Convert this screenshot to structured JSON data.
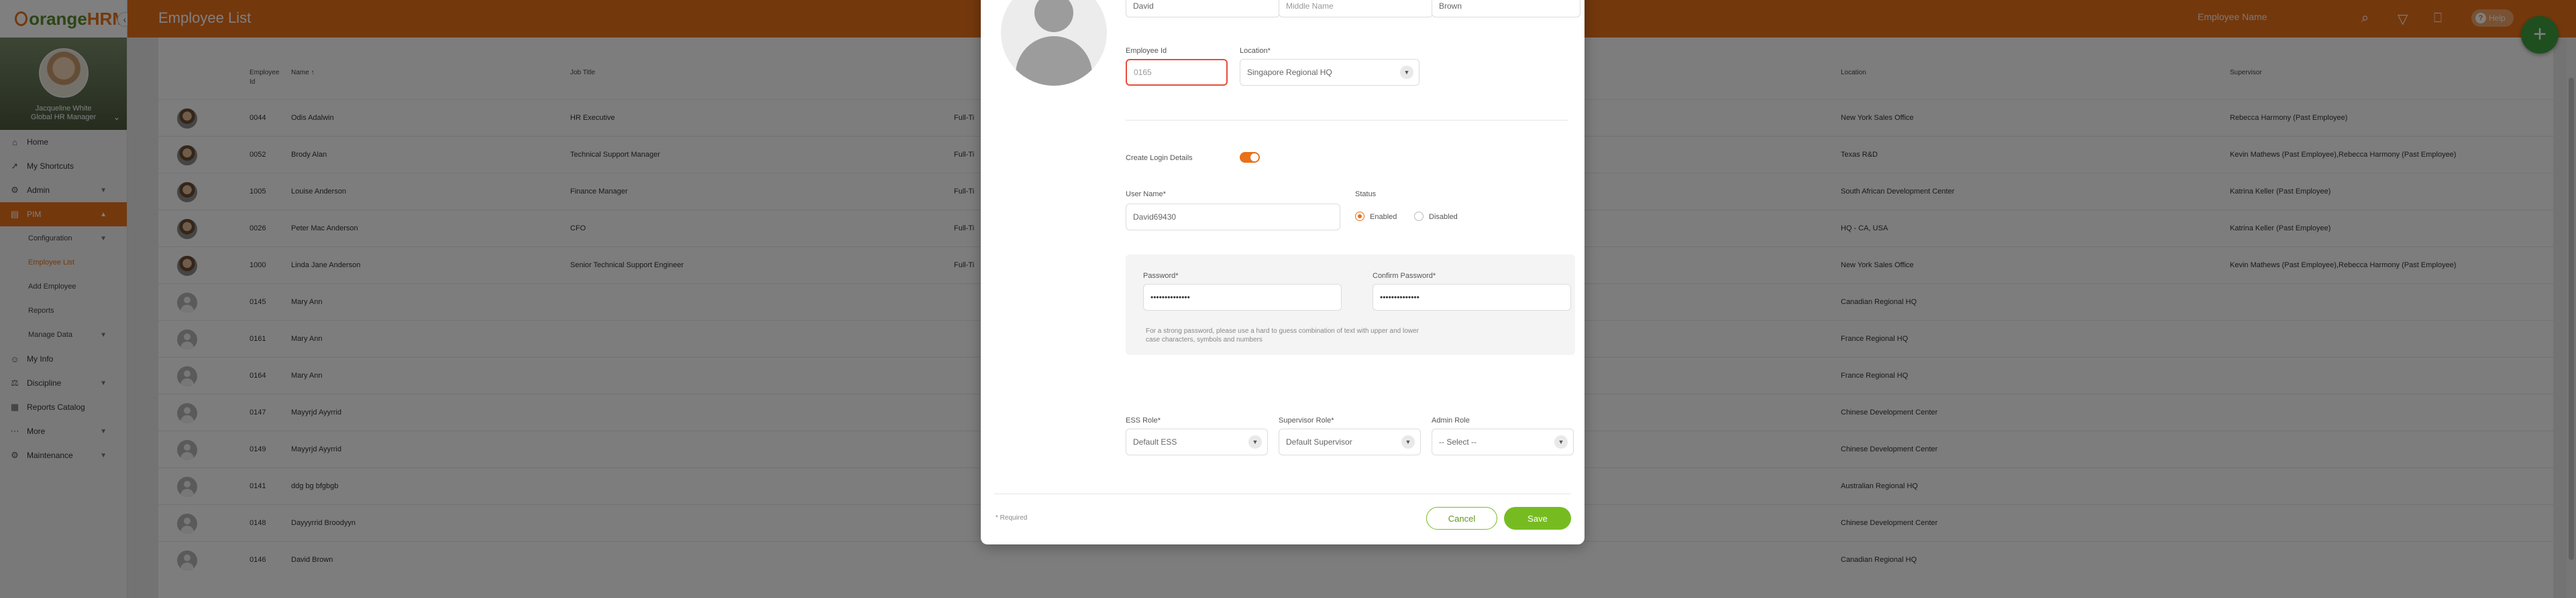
{
  "app": {
    "logo_orange": "orange",
    "logo_hrm": "HRM",
    "page_title": "Employee List",
    "top_search_placeholder": "Employee Name",
    "help_label": "Help",
    "fab_label": "+",
    "collapse_label": "‹"
  },
  "profile": {
    "name": "Jacqueline White",
    "role": "Global HR Manager"
  },
  "sidebar": {
    "items": [
      {
        "label": "Home",
        "icon": "home-icon"
      },
      {
        "label": "My Shortcuts",
        "icon": "shortcut-icon"
      },
      {
        "label": "Admin",
        "icon": "admin-icon"
      },
      {
        "label": "PIM",
        "icon": "pim-icon",
        "active": true
      },
      {
        "label": "Configuration",
        "sub": true
      },
      {
        "label": "Employee List",
        "sub": true,
        "current": true
      },
      {
        "label": "Add Employee",
        "sub": true
      },
      {
        "label": "Reports",
        "sub": true
      },
      {
        "label": "Manage Data",
        "sub": true
      },
      {
        "label": "My Info",
        "icon": "my-info-icon"
      },
      {
        "label": "Discipline",
        "icon": "discipline-icon"
      },
      {
        "label": "Reports Catalog",
        "icon": "reports-icon"
      },
      {
        "label": "More",
        "icon": "more-icon"
      },
      {
        "label": "Maintenance",
        "icon": "maintenance-icon"
      }
    ]
  },
  "table": {
    "headers": {
      "employee_id": "Employee Id",
      "name": "Name",
      "name_sort": "↑",
      "job_title": "Job Title",
      "location": "Location",
      "supervisor": "Supervisor"
    },
    "rows": [
      {
        "id": "0044",
        "name": "Odis Adalwin",
        "job": "HR Executive",
        "status": "Full-Ti",
        "location": "New York Sales Office",
        "supervisor": "Rebecca Harmony (Past Employee)",
        "photo": true
      },
      {
        "id": "0052",
        "name": "Brody Alan",
        "job": "Technical Support Manager",
        "status": "Full-Ti",
        "location": "Texas R&D",
        "supervisor": "Kevin Mathews (Past Employee),Rebecca Harmony (Past Employee)",
        "photo": true
      },
      {
        "id": "1005",
        "name": "Louise Anderson",
        "job": "Finance Manager",
        "status": "Full-Ti",
        "location": "South African Development Center",
        "supervisor": "Katrina Keller (Past Employee)",
        "photo": true
      },
      {
        "id": "0026",
        "name": "Peter Mac Anderson",
        "job": "CFO",
        "status": "Full-Ti",
        "location": "HQ - CA, USA",
        "supervisor": "Katrina Keller (Past Employee)",
        "photo": true
      },
      {
        "id": "1000",
        "name": "Linda Jane Anderson",
        "job": "Senior Technical Support Engineer",
        "status": "Full-Ti",
        "location": "New York Sales Office",
        "supervisor": "Kevin Mathews (Past Employee),Rebecca Harmony (Past Employee)",
        "photo": true
      },
      {
        "id": "0145",
        "name": "Mary Ann",
        "job": "",
        "status": "",
        "location": "Canadian Regional HQ",
        "supervisor": "",
        "photo": false
      },
      {
        "id": "0161",
        "name": "Mary Ann",
        "job": "",
        "status": "",
        "location": "France Regional HQ",
        "supervisor": "",
        "photo": false
      },
      {
        "id": "0164",
        "name": "Mary Ann",
        "job": "",
        "status": "",
        "location": "France Regional HQ",
        "supervisor": "",
        "photo": false
      },
      {
        "id": "0147",
        "name": "Mayyrjd Ayyrrid",
        "job": "",
        "status": "",
        "location": "Chinese Development Center",
        "supervisor": "",
        "photo": false
      },
      {
        "id": "0149",
        "name": "Mayyrjd Ayyrrid",
        "job": "",
        "status": "",
        "location": "Chinese Development Center",
        "supervisor": "",
        "photo": false
      },
      {
        "id": "0141",
        "name": "ddg bg bfgbgb",
        "job": "",
        "status": "",
        "location": "Australian Regional HQ",
        "supervisor": "",
        "photo": false
      },
      {
        "id": "0148",
        "name": "Dayyyrrid Broodyyn",
        "job": "",
        "status": "",
        "location": "Chinese Development Center",
        "supervisor": "",
        "photo": false
      },
      {
        "id": "0146",
        "name": "David Brown",
        "job": "",
        "status": "",
        "location": "Canadian Regional HQ",
        "supervisor": "",
        "photo": false
      }
    ]
  },
  "modal": {
    "first_name": "David",
    "middle_name_placeholder": "Middle Name",
    "last_name": "Brown",
    "employee_id_label": "Employee Id",
    "employee_id_value": "0165",
    "location_label": "Location*",
    "location_value": "Singapore Regional HQ",
    "create_login_label": "Create Login Details",
    "username_label": "User Name*",
    "username_value": "David69430",
    "status_label": "Status",
    "status_enabled": "Enabled",
    "status_disabled": "Disabled",
    "password_label": "Password*",
    "password_value": "••••••••••••••",
    "confirm_password_label": "Confirm Password*",
    "confirm_password_value": "••••••••••••••",
    "password_hint": "For a strong password, please use a hard to guess combination of text with upper and lower case characters, symbols and numbers",
    "ess_role_label": "ESS Role*",
    "ess_role_value": "Default ESS",
    "supervisor_role_label": "Supervisor Role*",
    "supervisor_role_value": "Default Supervisor",
    "admin_role_label": "Admin Role",
    "admin_role_value": "-- Select --",
    "required_note": "* Required",
    "cancel_label": "Cancel",
    "save_label": "Save"
  },
  "colors": {
    "brand_orange": "#e8711a",
    "brand_green": "#76bc21",
    "error": "#e74c3c"
  }
}
